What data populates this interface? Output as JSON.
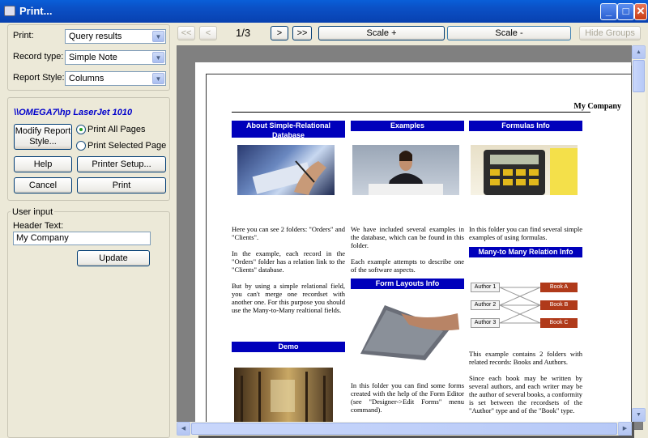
{
  "window": {
    "title": "Print..."
  },
  "settings": {
    "print_label": "Print:",
    "print_value": "Query results",
    "record_type_label": "Record type:",
    "record_type_value": "Simple Note",
    "report_style_label": "Report Style:",
    "report_style_value": "Columns"
  },
  "printer": {
    "name": "\\\\OMEGA7\\hp LaserJet 1010",
    "modify_label": "Modify Report Style...",
    "print_all_label": "Print All Pages",
    "print_selected_label": "Print Selected Page",
    "help_label": "Help",
    "printer_setup_label": "Printer Setup...",
    "cancel_label": "Cancel",
    "print_label": "Print"
  },
  "user_input": {
    "group_label": "User input",
    "header_text_label": "Header Text:",
    "header_text_value": "My Company",
    "update_label": "Update"
  },
  "toolbar": {
    "first": "<<",
    "prev": "<",
    "page_indicator": "1/3",
    "next": ">",
    "last": ">>",
    "scale_plus": "Scale +",
    "scale_minus": "Scale -",
    "hide_groups": "Hide Groups"
  },
  "preview": {
    "company": "My Company",
    "col1": {
      "heading": "About Simple-Relational Database",
      "p1": "Here you can see 2 folders: \"Orders\" and \"Clients\".",
      "p2": "In the example, each record in the \"Orders\" folder has a relation link to the \"Clients\" database.",
      "p3": "But by using a simple relational field, you can't merge one recordset with another one. For this purpose you should use the Many-to-Many realtional fields.",
      "demo_heading": "Demo"
    },
    "col2": {
      "heading": "Examples",
      "p1": "We have included several examples in the database, which can be found in this folder.",
      "p2": "Each example attempts to describe one of the software aspects.",
      "forms_heading": "Form Layouts Info",
      "p3": "In this folder you can find some forms created with the help of the Form Editor (see \"Designer->Edit Forms\" menu command)."
    },
    "col3": {
      "heading": "Formulas Info",
      "p1": "In this folder you can find several simple examples of using formulas.",
      "m2m_heading": "Many-to Many Relation Info",
      "authors": [
        "Author 1",
        "Author 2",
        "Author 3"
      ],
      "books": [
        "Book A",
        "Book B",
        "Book C"
      ],
      "p2": "This example contains 2 folders with related records: Books and Authors.",
      "p3": "Since each book may be written by several authors, and each writer may be the author of several books, a conformity is set between the recordsets of the \"Author\" type and of the \"Book\" type."
    }
  }
}
